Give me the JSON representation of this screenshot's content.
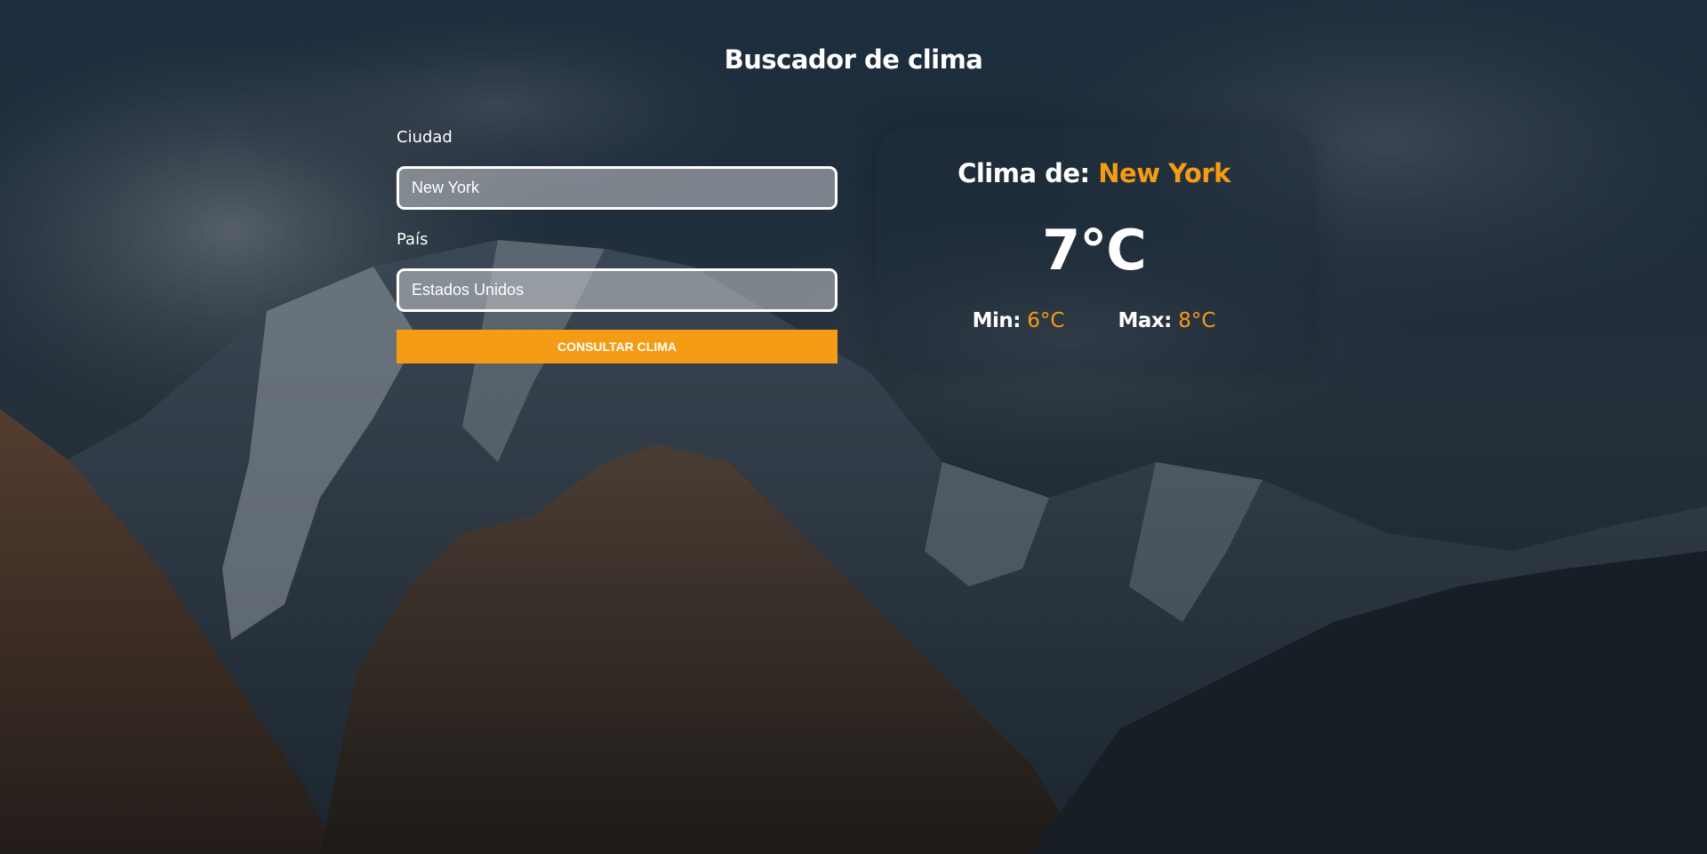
{
  "page": {
    "title": "Buscador de clima"
  },
  "form": {
    "city_label": "Ciudad",
    "city_value": "New York",
    "country_label": "País",
    "country_value": "Estados Unidos",
    "submit_label": "Consultar clima"
  },
  "result": {
    "heading_prefix": "Clima de:",
    "city": "New York",
    "temperature": "7°C",
    "min_label": "Min:",
    "min_value": "6°C",
    "max_label": "Max:",
    "max_value": "8°C"
  },
  "colors": {
    "accent": "#f59c14",
    "text": "#ffffff",
    "background": "#1e2833"
  }
}
